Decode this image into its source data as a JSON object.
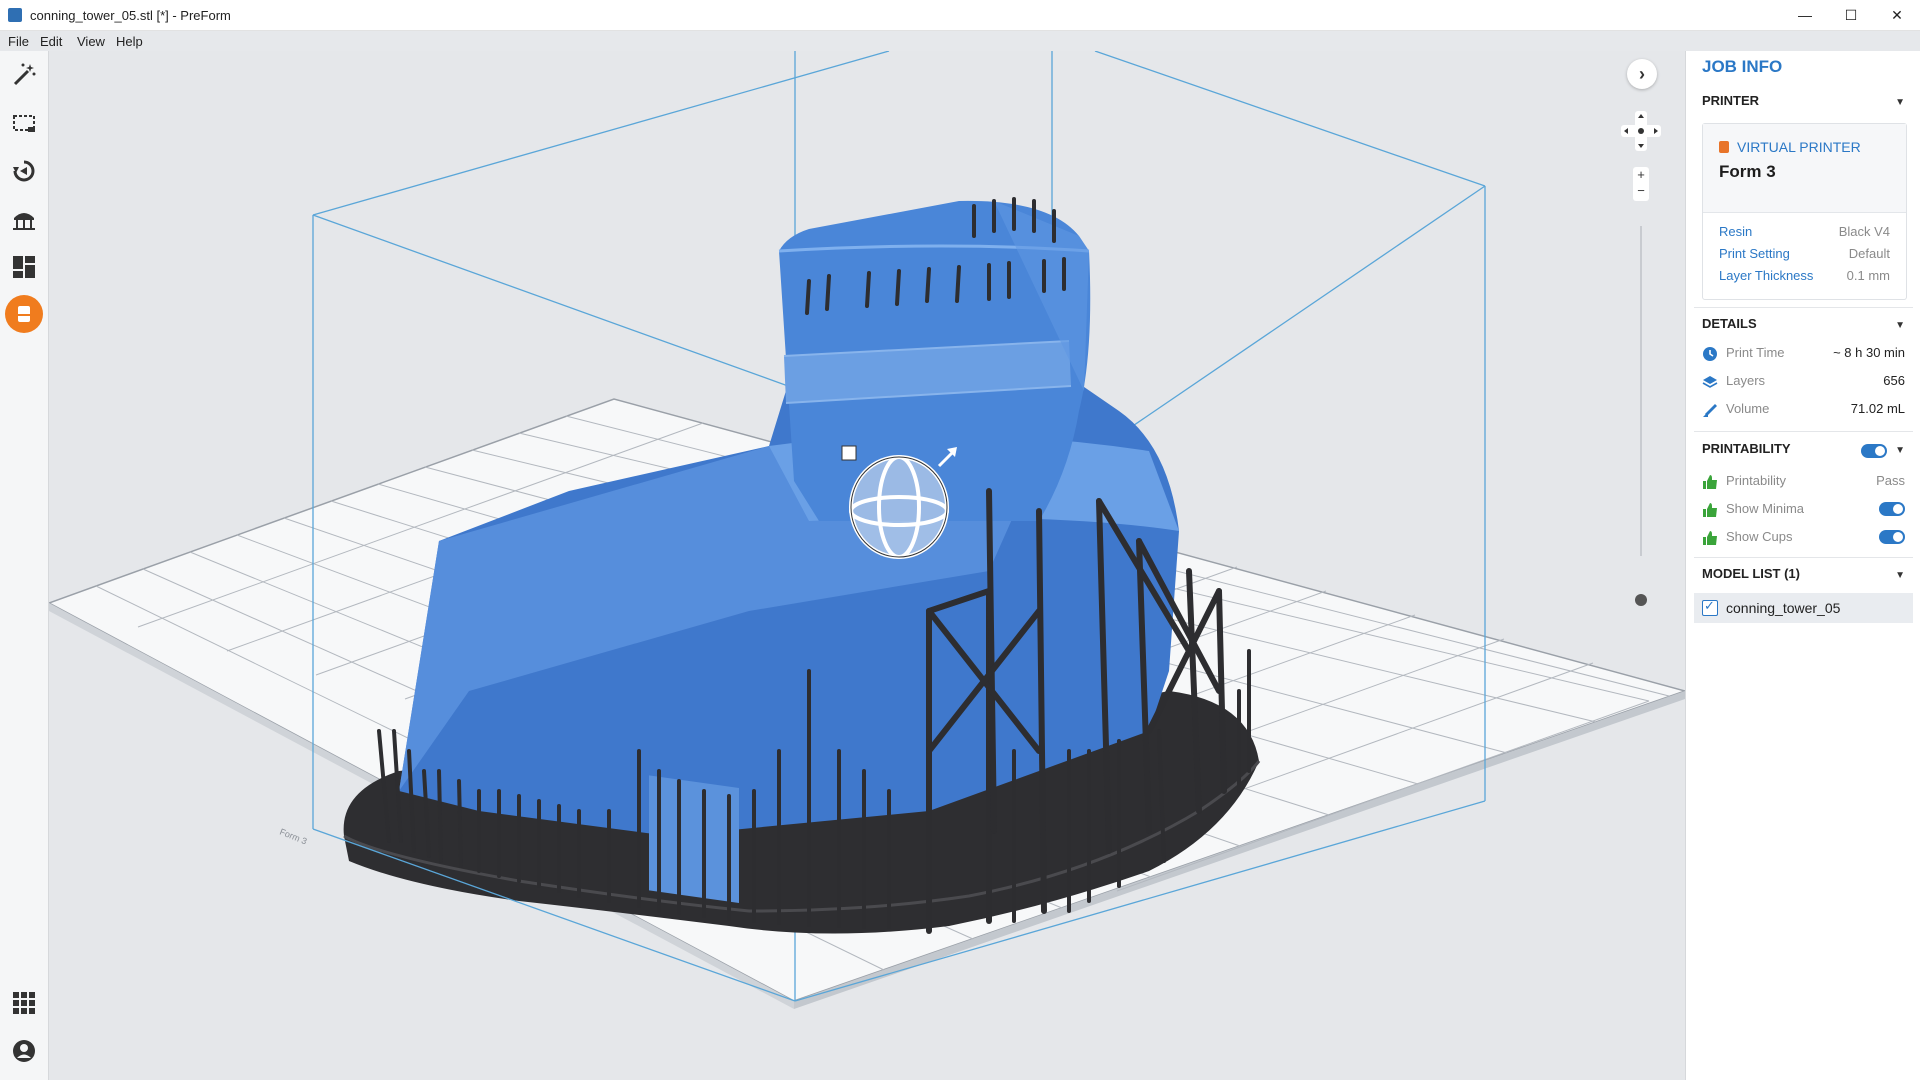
{
  "window": {
    "title": "conning_tower_05.stl [*] - PreForm",
    "minimize": "—",
    "maximize": "☐",
    "close": "✕"
  },
  "menu": [
    "File",
    "Edit",
    "View",
    "Help"
  ],
  "toolbar": {
    "tools": [
      "magic-wand-icon",
      "select-icon",
      "orientation-icon",
      "supports-icon",
      "layout-icon",
      "printer-icon"
    ],
    "bottom": [
      "apps-grid-icon",
      "account-icon"
    ]
  },
  "viewport": {
    "build_plate_label": "Form 3"
  },
  "job_info": {
    "title": "JOB INFO",
    "printer_section": "PRINTER",
    "printer_type": "VIRTUAL PRINTER",
    "printer_model": "Form 3",
    "resin_label": "Resin",
    "resin_value": "Black V4",
    "print_setting_label": "Print Setting",
    "print_setting_value": "Default",
    "layer_thickness_label": "Layer Thickness",
    "layer_thickness_value": "0.1 mm",
    "details_section": "DETAILS",
    "print_time_label": "Print Time",
    "print_time_value": "~ 8 h 30 min",
    "layers_label": "Layers",
    "layers_value": "656",
    "volume_label": "Volume",
    "volume_value": "71.02 mL",
    "printability_section": "PRINTABILITY",
    "printability_label": "Printability",
    "printability_value": "Pass",
    "show_minima_label": "Show Minima",
    "show_cups_label": "Show Cups",
    "model_list_section": "MODEL LIST (1)",
    "model_item": "conning_tower_05"
  },
  "colors": {
    "accent": "#2b78c6",
    "active_tool": "#f07c1e",
    "model_blue": "#4a86d8",
    "supports": "#2f2f31"
  }
}
